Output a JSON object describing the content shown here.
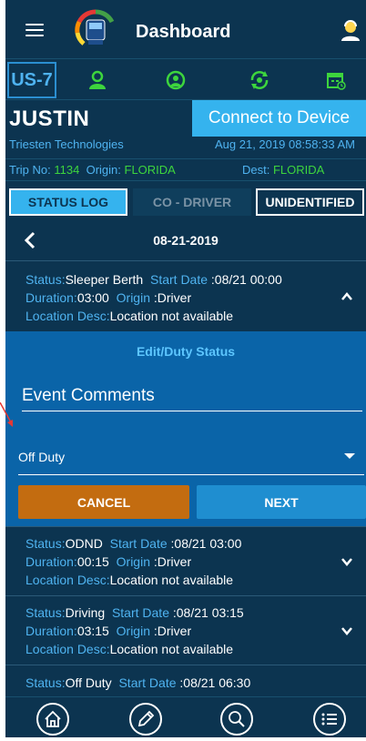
{
  "header": {
    "title": "Dashboard"
  },
  "vehicle": {
    "id": "US-7"
  },
  "driver": {
    "name": "JUSTIN",
    "company": "Triesten Technologies",
    "connect_label": "Connect to Device",
    "datetime": "Aug 21, 2019 08:58:33 AM"
  },
  "trip": {
    "trip_label": "Trip No:",
    "trip_no": "1134",
    "origin_label": "Origin:",
    "origin": "FLORIDA",
    "dest_label": "Dest:",
    "dest": "FLORIDA"
  },
  "tabs": {
    "status_log": "STATUS LOG",
    "co_driver": "CO - DRIVER",
    "unidentified": "UNIDENTIFIED"
  },
  "date_nav": {
    "date": "08-21-2019"
  },
  "labels": {
    "status": "Status:",
    "start_date": "Start Date",
    "duration": "Duration:",
    "origin": "Origin",
    "location_desc": "Location Desc:"
  },
  "logs": [
    {
      "status": "Sleeper Berth",
      "start_date": ":08/21 00:00",
      "duration": "03:00",
      "origin": ":Driver",
      "location": "Location not available"
    },
    {
      "status": "ODND",
      "start_date": ":08/21 03:00",
      "duration": "00:15",
      "origin": ":Driver",
      "location": "Location not available"
    },
    {
      "status": "Driving",
      "start_date": ":08/21 03:15",
      "duration": "03:15",
      "origin": ":Driver",
      "location": "Location not available"
    },
    {
      "status": "Off Duty",
      "start_date": ":08/21 06:30"
    }
  ],
  "edit_panel": {
    "title": "Edit/Duty Status",
    "comments_placeholder": "Event Comments",
    "selected_status": "Off Duty",
    "cancel_label": "CANCEL",
    "next_label": "NEXT"
  },
  "colors": {
    "background": "#0c3450",
    "accent": "#35b3ee",
    "label_blue": "#4fb3f0",
    "green": "#3dd53d",
    "edit_panel": "#0a64a8",
    "cancel": "#c36c10",
    "next": "#1f8ed0"
  },
  "icons": {
    "header": [
      "menu-icon",
      "truck-logo",
      "driver-profile-icon"
    ],
    "vehicle_row": [
      "driver-icon",
      "co-driver-icon",
      "sync-icon",
      "calendar-icon"
    ],
    "bottom_nav": [
      "home-icon",
      "edit-icon",
      "search-icon",
      "list-icon"
    ]
  }
}
